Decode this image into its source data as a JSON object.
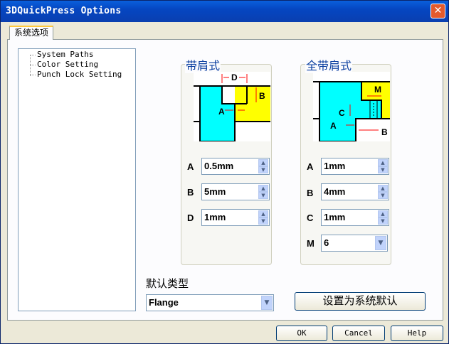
{
  "window": {
    "title": "3DQuickPress Options",
    "close_glyph": "✕"
  },
  "tab": {
    "label": "系统选项"
  },
  "tree": {
    "items": [
      "System Paths",
      "Color Setting",
      "Punch Lock Setting"
    ]
  },
  "group_left": {
    "title": "带肩式",
    "diagram_labels": {
      "D": "D",
      "B": "B",
      "A": "A"
    },
    "fields": [
      {
        "label": "A",
        "value": "0.5mm"
      },
      {
        "label": "B",
        "value": "5mm"
      },
      {
        "label": "D",
        "value": "1mm"
      }
    ]
  },
  "group_right": {
    "title": "全带肩式",
    "diagram_labels": {
      "M": "M",
      "C": "C",
      "A": "A",
      "B": "B"
    },
    "fields": [
      {
        "label": "A",
        "value": "1mm"
      },
      {
        "label": "B",
        "value": "4mm"
      },
      {
        "label": "C",
        "value": "1mm"
      }
    ],
    "select": {
      "label": "M",
      "value": "6"
    }
  },
  "default_type": {
    "label": "默认类型",
    "value": "Flange"
  },
  "set_default_button": "设置为系统默认",
  "footer": {
    "ok": "OK",
    "cancel": "Cancel",
    "help": "Help"
  },
  "colors": {
    "cyan": "#00ffff",
    "yellow": "#ffff00",
    "red": "#ff0000",
    "title_blue": "#0b3fa0"
  }
}
